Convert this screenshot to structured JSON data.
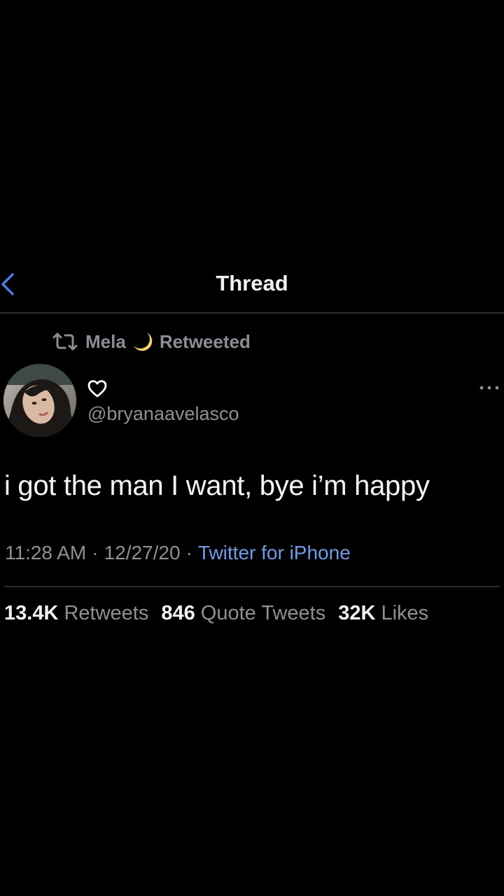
{
  "header": {
    "title": "Thread",
    "back_icon": "chevron-left-icon"
  },
  "colors": {
    "background": "#000000",
    "accent": "#4a7fe0",
    "link": "#6d9ce8",
    "secondary_text": "#8e9096",
    "divider": "#2a2a2f"
  },
  "retweet_context": {
    "icon": "retweet-icon",
    "user": "Mela",
    "emoji": "crescent-moon-icon",
    "label": "Retweeted"
  },
  "tweet": {
    "display_name_icon": "heart-outline-icon",
    "handle": "@bryanaavelasco",
    "more_icon": "more-horizontal-icon",
    "text": "i got the man I want, bye i’m happy",
    "time": "11:28 AM",
    "separator": "·",
    "date": "12/27/20",
    "client": "Twitter for iPhone"
  },
  "stats": {
    "retweets_count": "13.4K",
    "retweets_label": "Retweets",
    "quote_tweets_count": "846",
    "quote_tweets_label": "Quote Tweets",
    "likes_count": "32K",
    "likes_label": "Likes"
  }
}
